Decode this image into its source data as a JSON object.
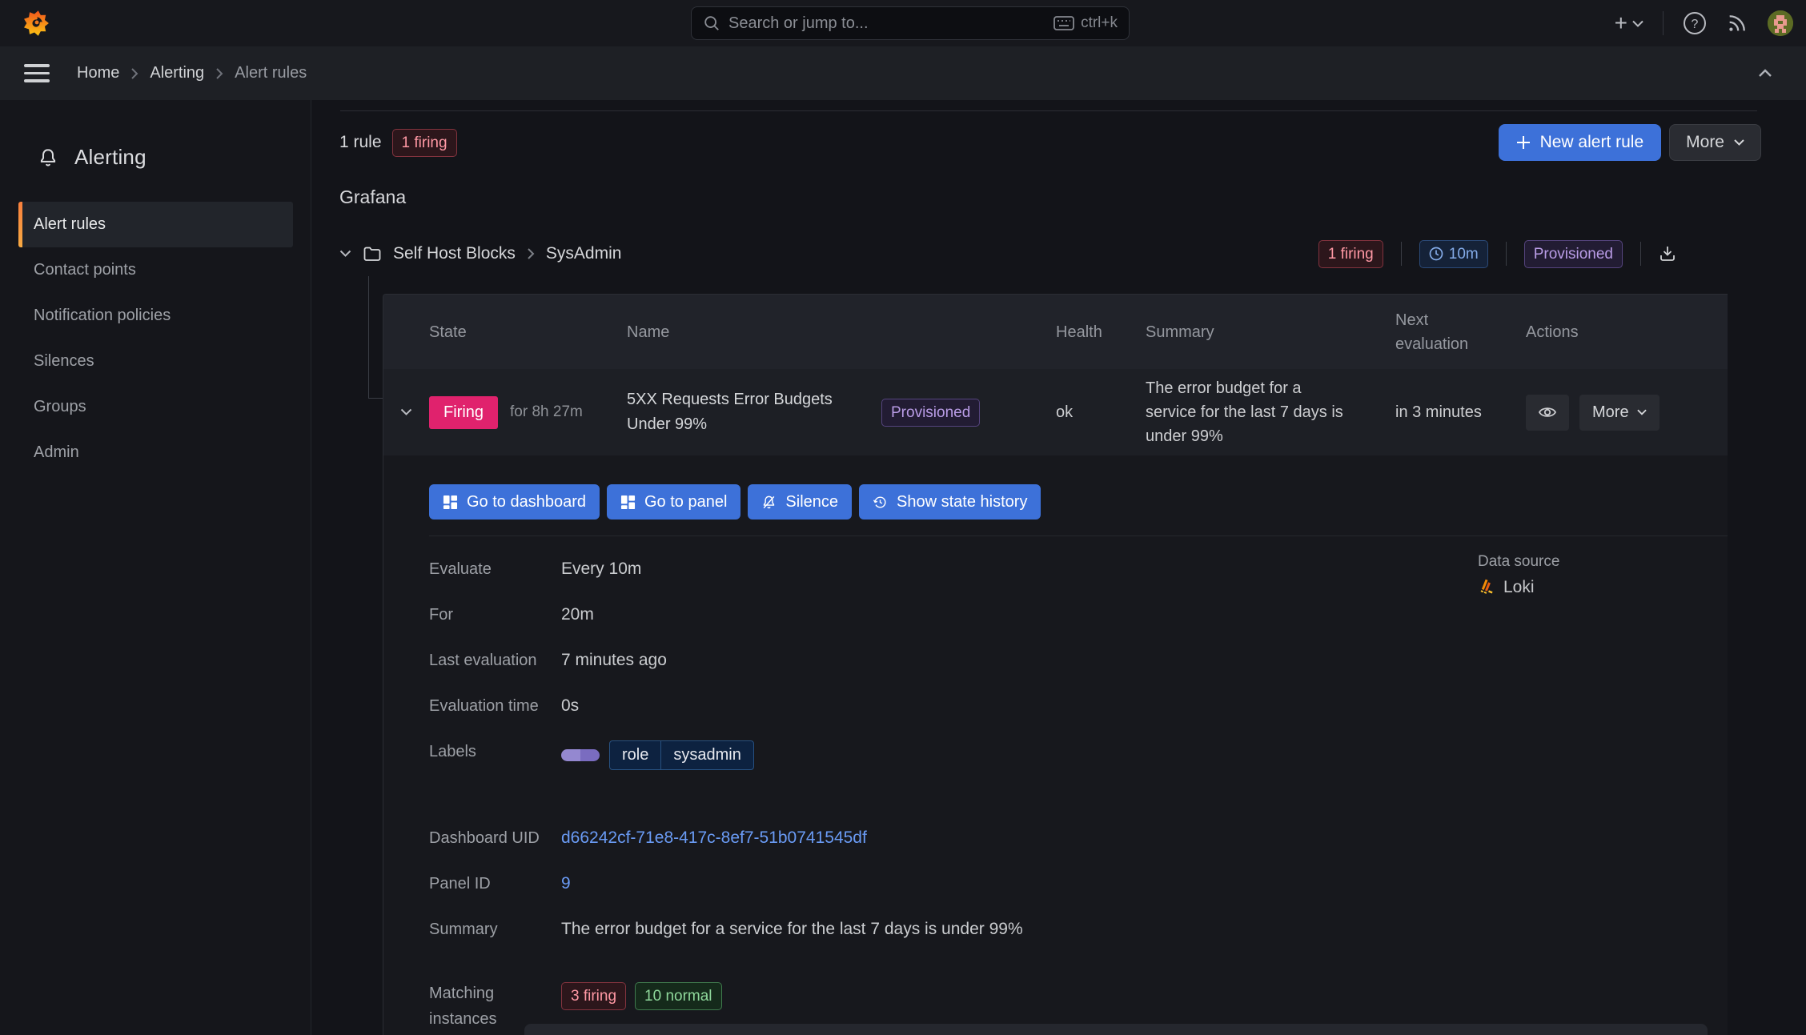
{
  "topbar": {
    "search_placeholder": "Search or jump to...",
    "shortcut": "ctrl+k"
  },
  "breadcrumb": {
    "home": "Home",
    "section": "Alerting",
    "current": "Alert rules"
  },
  "sidebar": {
    "title": "Alerting",
    "items": [
      {
        "label": "Alert rules",
        "active": true
      },
      {
        "label": "Contact points",
        "active": false
      },
      {
        "label": "Notification policies",
        "active": false
      },
      {
        "label": "Silences",
        "active": false
      },
      {
        "label": "Groups",
        "active": false
      },
      {
        "label": "Admin",
        "active": false
      }
    ]
  },
  "header": {
    "rule_count": "1 rule",
    "firing_badge": "1 firing",
    "new_alert_rule": "New alert rule",
    "more": "More"
  },
  "section_title": "Grafana",
  "folder": {
    "name": "Self Host Blocks",
    "separator": "›",
    "subfolder": "SysAdmin",
    "firing_badge": "1 firing",
    "interval": "10m",
    "provisioned": "Provisioned"
  },
  "table": {
    "headers": {
      "state": "State",
      "name": "Name",
      "health": "Health",
      "summary": "Summary",
      "next_evaluation": "Next evaluation",
      "actions": "Actions"
    }
  },
  "rule": {
    "state": "Firing",
    "duration": "for 8h 27m",
    "name": "5XX Requests Error Budgets Under 99%",
    "provisioned": "Provisioned",
    "health": "ok",
    "summary": "The error budget for a service for the last 7 days is under 99%",
    "next_evaluation": "in 3 minutes",
    "more": "More"
  },
  "actions": {
    "go_to_dashboard": "Go to dashboard",
    "go_to_panel": "Go to panel",
    "silence": "Silence",
    "show_state_history": "Show state history"
  },
  "details": {
    "evaluate_label": "Evaluate",
    "evaluate_value": "Every 10m",
    "for_label": "For",
    "for_value": "20m",
    "last_evaluation_label": "Last evaluation",
    "last_evaluation_value": "7 minutes ago",
    "evaluation_time_label": "Evaluation time",
    "evaluation_time_value": "0s",
    "labels_label": "Labels",
    "label_key": "role",
    "label_value": "sysadmin",
    "datasource_label": "Data source",
    "datasource_name": "Loki",
    "dashboard_uid_label": "Dashboard UID",
    "dashboard_uid_value": "d66242cf-71e8-417c-8ef7-51b0741545df",
    "panel_id_label": "Panel ID",
    "panel_id_value": "9",
    "summary_label": "Summary",
    "summary_value": "The error budget for a service for the last 7 days is under 99%",
    "matching_label": "Matching instances",
    "matching_firing": "3 firing",
    "matching_normal": "10 normal"
  },
  "colors": {
    "primary_blue": "#3D71D9",
    "firing_red": "#E0226D",
    "link_blue": "#6A9BF5",
    "badge_red_text": "#FF98A4",
    "badge_green_text": "#8FD89B",
    "badge_blue_text": "#84ABE8",
    "badge_purple_text": "#B99CE6",
    "accent_orange": "#FF7B33"
  }
}
